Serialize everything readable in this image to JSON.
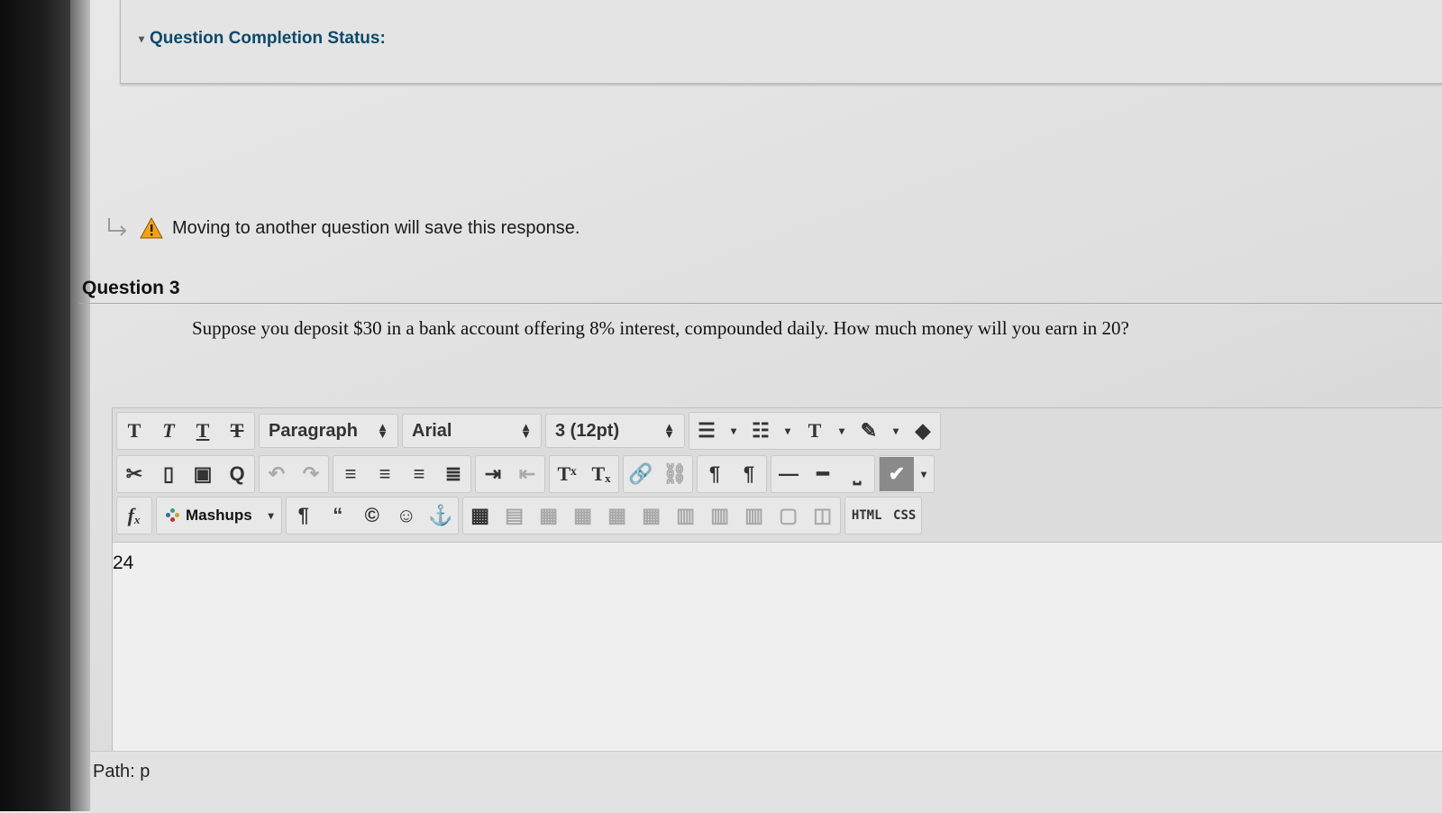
{
  "status": {
    "label": "Question Completion Status:"
  },
  "notice": {
    "text": "Moving to another question will save this response."
  },
  "question": {
    "title": "Question 3",
    "text": "Suppose  you deposit $30 in a bank account offering 8% interest, compounded daily. How much money will you earn in 20?"
  },
  "editor": {
    "paragraph_select": "Paragraph",
    "font_select": "Arial",
    "size_select": "3 (12pt)",
    "mashups_label": "Mashups",
    "html_label": "HTML",
    "css_label": "CSS",
    "content": "24",
    "path": "Path: p"
  },
  "colors": {
    "status_link": "#0b4a6b",
    "warning": "#f2a01b"
  }
}
